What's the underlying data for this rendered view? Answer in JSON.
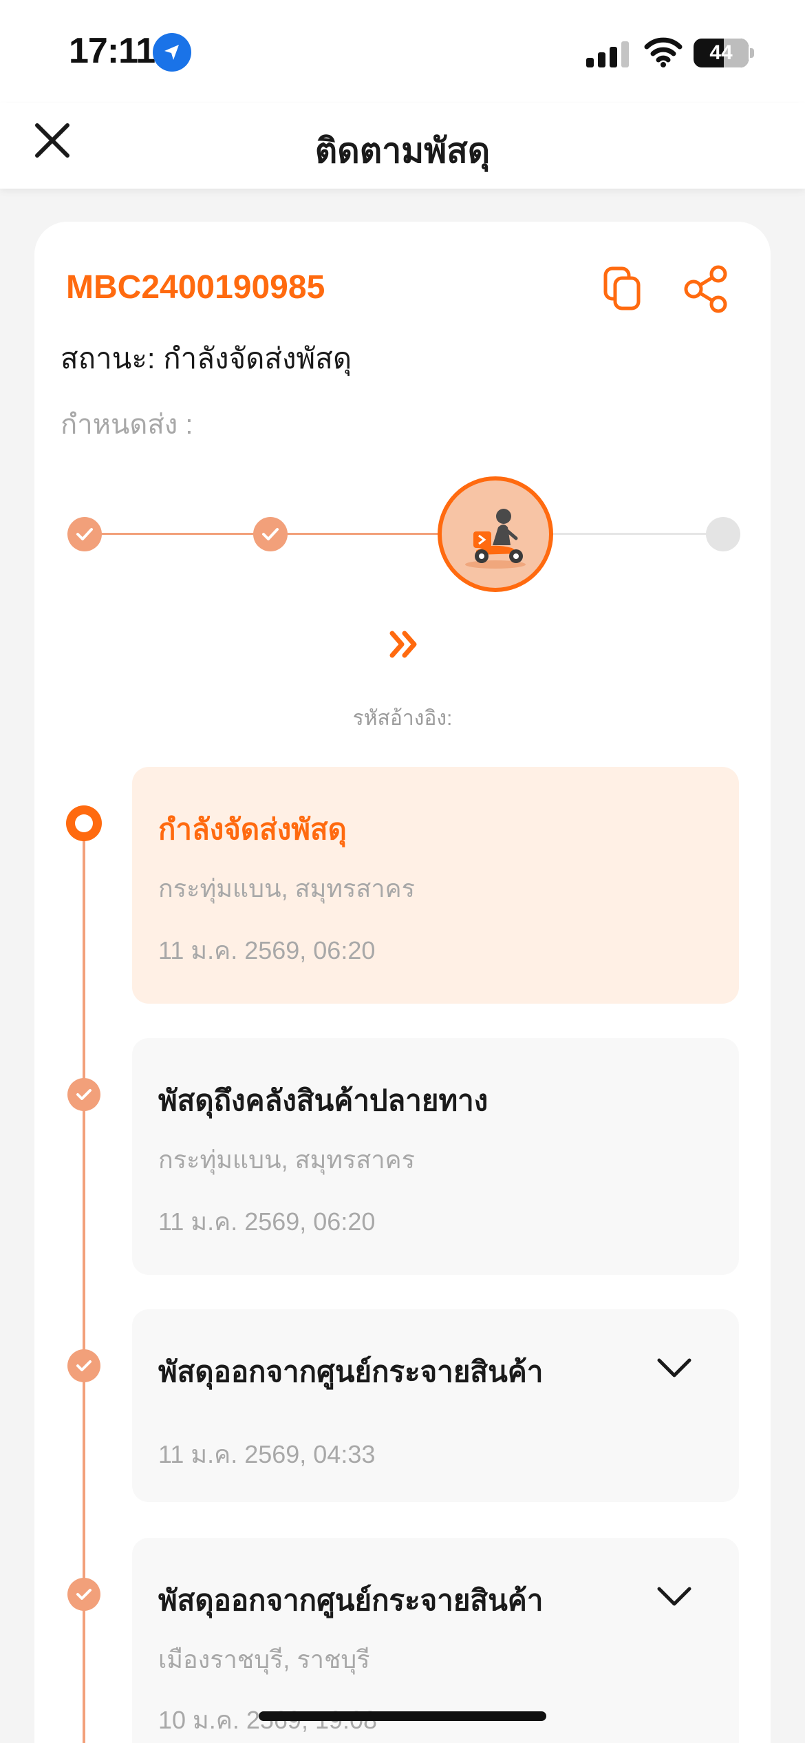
{
  "status_bar": {
    "time": "17:11",
    "battery": "44"
  },
  "header": {
    "title": "ติดตามพัสดุ",
    "close_icon": "close-icon"
  },
  "parcel": {
    "tracking_number": "MBC2400190985",
    "status_text": "สถานะ: กำลังจัดส่งพัสดุ",
    "deadline_text": "กำหนดส่ง :",
    "reference_text": "รหัสอ้างอิง:",
    "progress": {
      "completed_steps": 2,
      "current_step": 3,
      "total_steps": 4
    }
  },
  "events": [
    {
      "title": "กำลังจัดส่งพัสดุ",
      "location": "กระทุ่มแบน, สมุทรสาคร",
      "time": "11 ม.ค. 2569, 06:20",
      "current": true
    },
    {
      "title": "พัสดุถึงคลังสินค้าปลายทาง",
      "location": "กระทุ่มแบน, สมุทรสาคร",
      "time": "11 ม.ค. 2569, 06:20"
    },
    {
      "title": "พัสดุออกจากศูนย์กระจายสินค้า",
      "location": "",
      "time": "11 ม.ค. 2569, 04:33",
      "expandable": true
    },
    {
      "title": "พัสดุออกจากศูนย์กระจายสินค้า",
      "location": "เมืองราชบุรี, ราชบุรี",
      "time": "10 ม.ค. 2569, 19:08",
      "expandable": true
    }
  ],
  "colors": {
    "accent": "#ff6a0f",
    "accent_light": "#f2a07a",
    "current_event_bg": "#fff0e5",
    "pending": "#e4e4e4"
  }
}
